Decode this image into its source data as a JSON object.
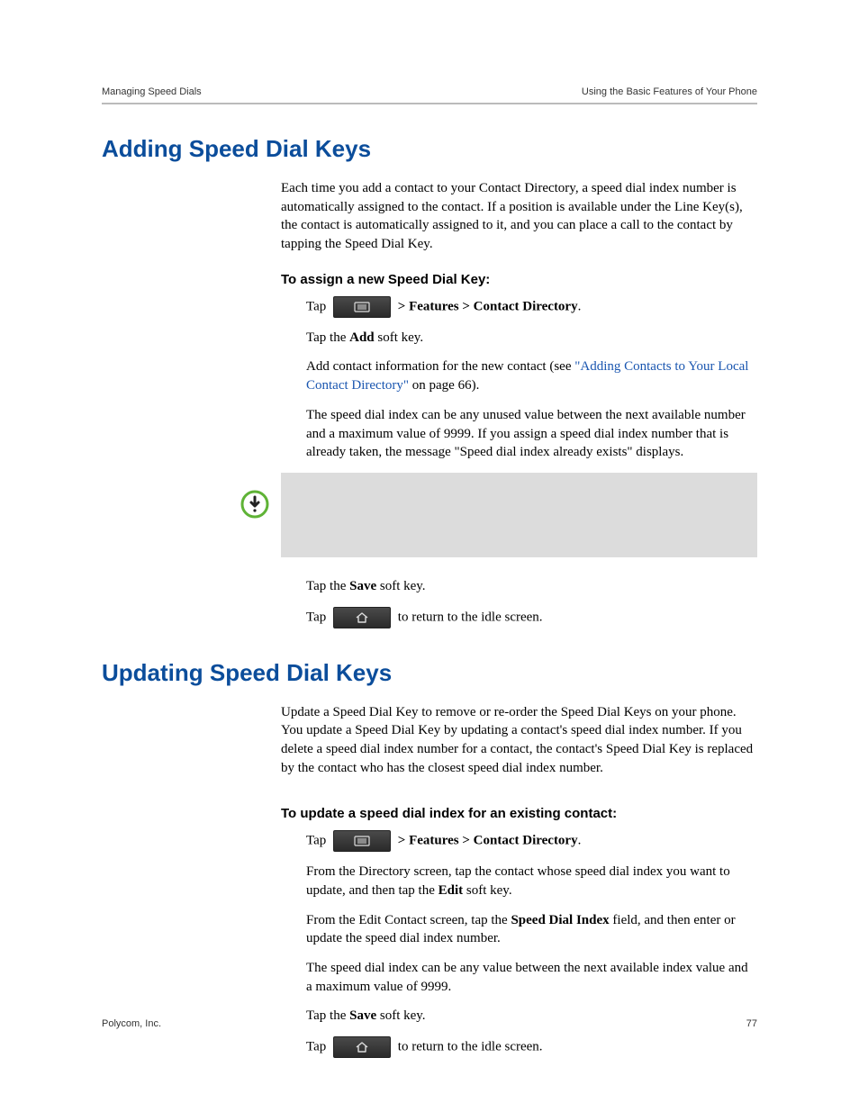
{
  "header": {
    "left": "Managing Speed Dials",
    "right": "Using the Basic Features of Your Phone"
  },
  "section1": {
    "title": "Adding Speed Dial Keys",
    "intro": "Each time you add a contact to your Contact Directory, a speed dial index number is automatically assigned to the contact. If a position is available under the Line Key(s), the contact is automatically assigned to it, and you can place a call to the contact by tapping the Speed Dial Key.",
    "subhead": "To assign a new Speed Dial Key:",
    "step1_pre": "Tap ",
    "step1_post": " > Features > Contact Directory",
    "step1_end": ".",
    "step2_pre": "Tap the ",
    "step2_bold": "Add",
    "step2_post": " soft key.",
    "step3_pre": "Add contact information for the new contact (see ",
    "step3_link": "\"Adding Contacts to Your Local Contact Directory\"",
    "step3_post": " on page 66).",
    "step4": "The speed dial index can be any unused value between the next available number and a maximum value of 9999. If you assign a speed dial index number that is already taken, the message \"Speed dial index already exists\" displays.",
    "note": "",
    "step5_pre": "Tap the ",
    "step5_bold": "Save",
    "step5_post": " soft key.",
    "step6_pre": "Tap ",
    "step6_post": " to return to the idle screen."
  },
  "section2": {
    "title": "Updating Speed Dial Keys",
    "intro": "Update a Speed Dial Key to remove or re-order the Speed Dial Keys on your phone. You update a Speed Dial Key by updating a contact's speed dial index number. If you delete a speed dial index number for a contact, the contact's Speed Dial Key is replaced by the contact who has the closest speed dial index number.",
    "subhead": "To update a speed dial index for an existing contact:",
    "step1_pre": "Tap ",
    "step1_post": " > Features > Contact Directory",
    "step1_end": ".",
    "step2_pre": "From the Directory screen, tap the contact whose speed dial index you want to update, and then tap the ",
    "step2_bold": "Edit",
    "step2_post": " soft key.",
    "step3_pre": "From the Edit Contact screen, tap the ",
    "step3_bold": "Speed Dial Index",
    "step3_post": " field, and then enter or update the speed dial index number.",
    "step4": "The speed dial index can be any value between the next available index value and a maximum value of 9999.",
    "step5_pre": "Tap the ",
    "step5_bold": "Save",
    "step5_post": " soft key.",
    "step6_pre": "Tap ",
    "step6_post": " to return to the idle screen."
  },
  "footer": {
    "left": "Polycom, Inc.",
    "right": "77"
  }
}
